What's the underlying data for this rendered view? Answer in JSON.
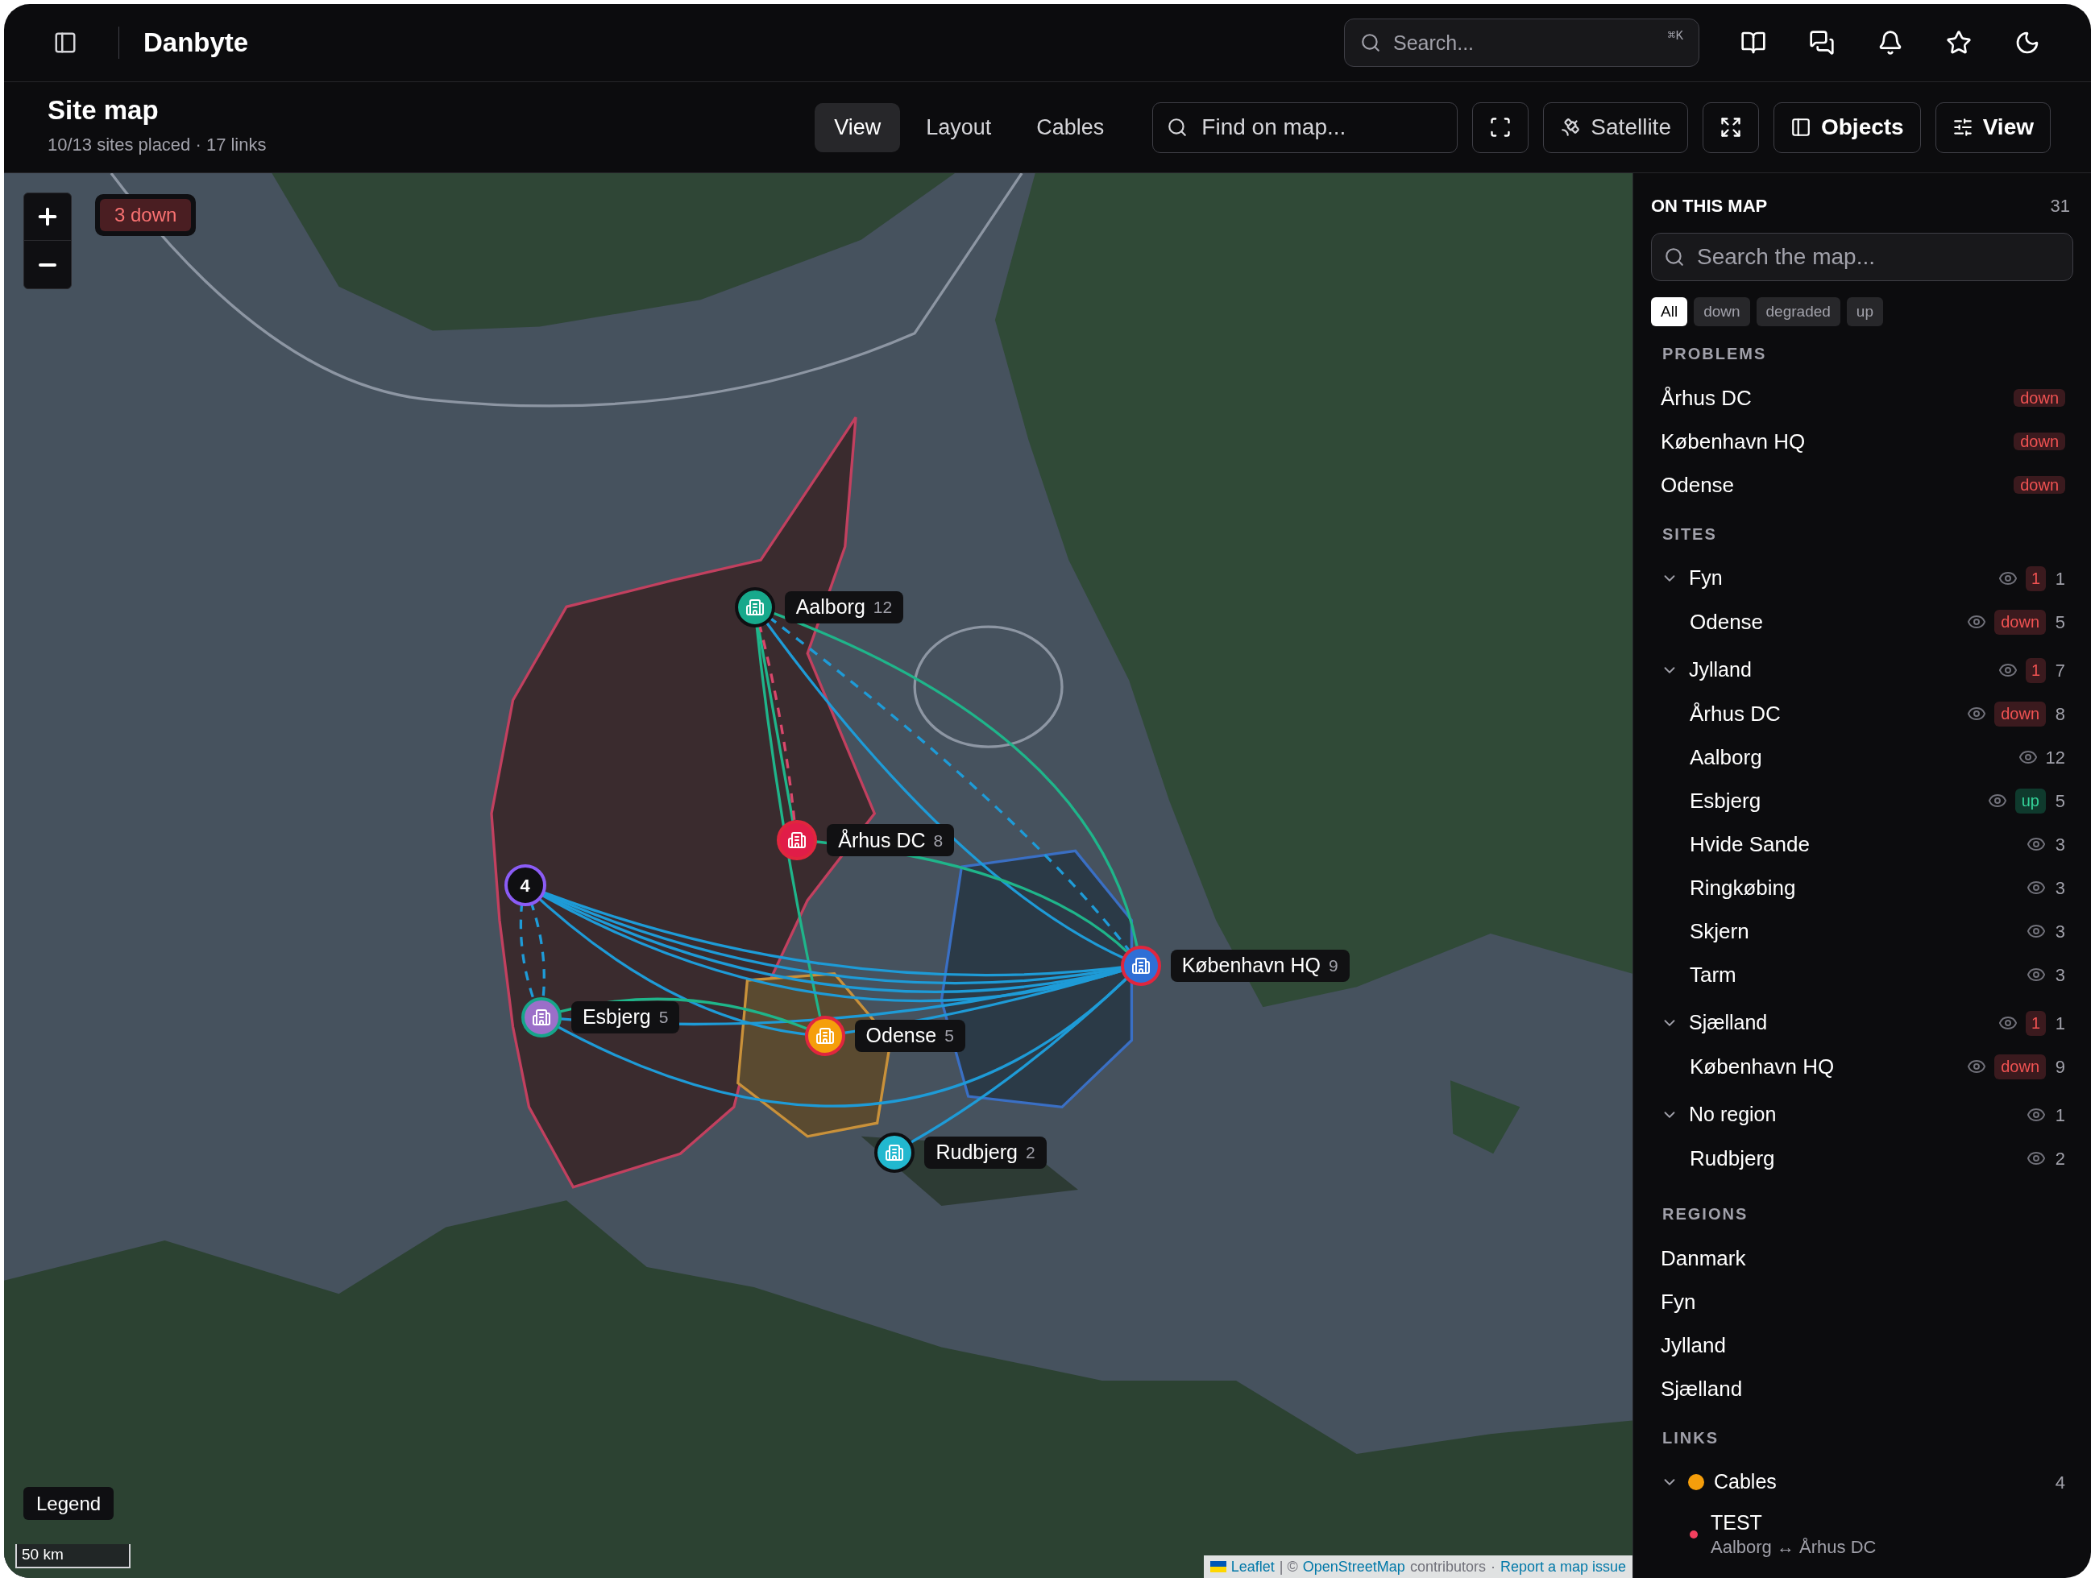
{
  "topbar": {
    "brand": "Danbyte",
    "search": {
      "placeholder": "Search...",
      "shortcut": "⌘K"
    }
  },
  "header": {
    "title": "Site map",
    "subtitle": "10/13 sites placed · 17 links",
    "tabs": [
      {
        "label": "View",
        "selected": true
      },
      {
        "label": "Layout",
        "selected": false
      },
      {
        "label": "Cables",
        "selected": false
      }
    ],
    "find": {
      "placeholder": "Find on map..."
    },
    "satellite": "Satellite",
    "objects": "Objects",
    "view_menu": "View"
  },
  "map": {
    "down_badge": "3 down",
    "markers": [
      {
        "name": "Aalborg",
        "count": "12",
        "color": "#17a98c",
        "kind": "plain"
      },
      {
        "name": "Århus DC",
        "count": "8",
        "color": "#e11d48",
        "kind": "down"
      },
      {
        "name": "Esbjerg",
        "count": "5",
        "color": "#9b6fc9",
        "kind": "up"
      },
      {
        "name": "Odense",
        "count": "5",
        "color": "#f59e0b",
        "kind": "down"
      },
      {
        "name": "København HQ",
        "count": "9",
        "color": "#2f6fd6",
        "kind": "down"
      },
      {
        "name": "Rudbjerg",
        "count": "2",
        "color": "#22b8cf",
        "kind": "plain"
      }
    ],
    "cluster": {
      "count": "4"
    },
    "legend": "Legend",
    "scale": "50 km",
    "attribution": {
      "leaflet": "Leaflet",
      "separator": "| ©",
      "osm": "OpenStreetMap",
      "contributors": "contributors",
      "dot": "·",
      "report": "Report a map issue"
    }
  },
  "sidebar": {
    "title": "ON THIS MAP",
    "count": "31",
    "search": {
      "placeholder": "Search the map..."
    },
    "filters": [
      {
        "label": "All",
        "selected": true
      },
      {
        "label": "down",
        "selected": false
      },
      {
        "label": "degraded",
        "selected": false
      },
      {
        "label": "up",
        "selected": false
      }
    ],
    "problems": {
      "heading": "PROBLEMS",
      "items": [
        {
          "name": "Århus DC",
          "badge": "down",
          "kind": "down"
        },
        {
          "name": "København HQ",
          "badge": "down",
          "kind": "down"
        },
        {
          "name": "Odense",
          "badge": "down",
          "kind": "down"
        }
      ]
    },
    "sites": {
      "heading": "SITES",
      "groups": [
        {
          "name": "Fyn",
          "expanded": true,
          "visible": true,
          "alert": "1",
          "count": "1",
          "children": [
            {
              "name": "Odense",
              "visible": true,
              "badge": "down",
              "kind": "down",
              "count": "5"
            }
          ]
        },
        {
          "name": "Jylland",
          "expanded": true,
          "visible": true,
          "alert": "1",
          "count": "7",
          "children": [
            {
              "name": "Århus DC",
              "visible": true,
              "badge": "down",
              "kind": "down",
              "count": "8"
            },
            {
              "name": "Aalborg",
              "visible": true,
              "count": "12"
            },
            {
              "name": "Esbjerg",
              "visible": true,
              "badge": "up",
              "kind": "up",
              "count": "5"
            },
            {
              "name": "Hvide Sande",
              "visible": true,
              "count": "3"
            },
            {
              "name": "Ringkøbing",
              "visible": true,
              "count": "3"
            },
            {
              "name": "Skjern",
              "visible": true,
              "count": "3"
            },
            {
              "name": "Tarm",
              "visible": true,
              "count": "3"
            }
          ]
        },
        {
          "name": "Sjælland",
          "expanded": true,
          "visible": true,
          "alert": "1",
          "count": "1",
          "children": [
            {
              "name": "København HQ",
              "visible": true,
              "badge": "down",
              "kind": "down",
              "count": "9"
            }
          ]
        },
        {
          "name": "No region",
          "expanded": true,
          "visible": true,
          "count": "1",
          "children": [
            {
              "name": "Rudbjerg",
              "visible": true,
              "count": "2"
            }
          ]
        }
      ]
    },
    "regions": {
      "heading": "REGIONS",
      "items": [
        "Danmark",
        "Fyn",
        "Jylland",
        "Sjælland"
      ]
    },
    "links": {
      "heading": "LINKS",
      "groups": [
        {
          "name": "Cables",
          "color": "#f59e0b",
          "count": "4",
          "expanded": true,
          "children": [
            {
              "name": "TEST",
              "color": "#f43f5e",
              "route": "Aalborg ↔ Århus DC"
            }
          ]
        }
      ]
    }
  }
}
